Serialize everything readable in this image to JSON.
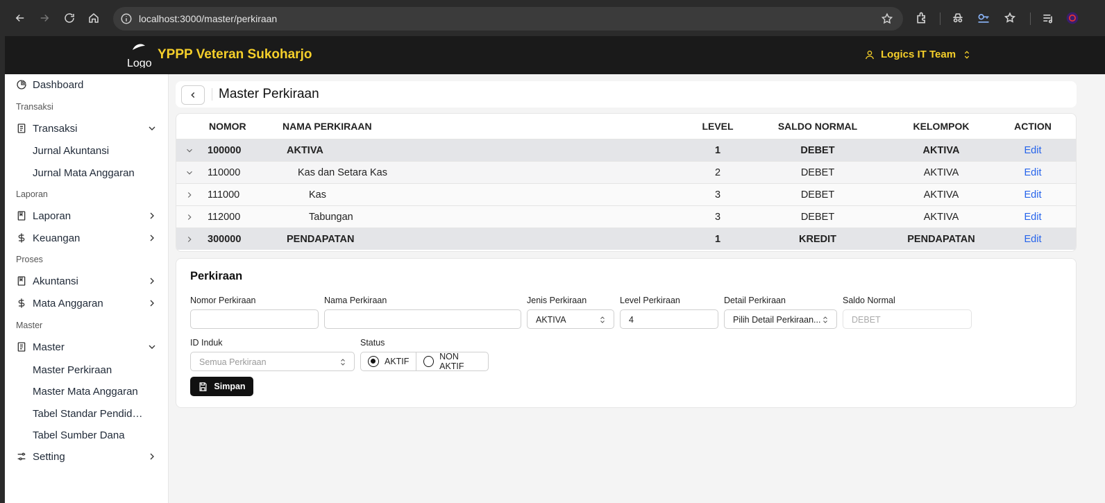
{
  "browser": {
    "url": "localhost:3000/master/perkiraan"
  },
  "header": {
    "logo_alt": "Logo",
    "title": "YPPP Veteran Sukoharjo",
    "team": "Logics IT Team"
  },
  "sidebar": {
    "dashboard": "Dashboard",
    "sections": {
      "transaksi": "Transaksi",
      "laporan": "Laporan",
      "proses": "Proses",
      "master": "Master"
    },
    "items": {
      "transaksi": "Transaksi",
      "jurnal_akuntansi": "Jurnal Akuntansi",
      "jurnal_mata_anggaran": "Jurnal Mata Anggaran",
      "laporan": "Laporan",
      "keuangan": "Keuangan",
      "akuntansi": "Akuntansi",
      "mata_anggaran": "Mata Anggaran",
      "master": "Master",
      "master_perkiraan": "Master Perkiraan",
      "master_mata_anggaran": "Master Mata Anggaran",
      "tabel_standar": "Tabel Standar Pendidik…",
      "tabel_sumber_dana": "Tabel Sumber Dana",
      "setting": "Setting"
    }
  },
  "page": {
    "title": "Master Perkiraan"
  },
  "table": {
    "headers": {
      "nomor": "NOMOR",
      "nama": "NAMA PERKIRAAN",
      "level": "LEVEL",
      "saldo": "SALDO NORMAL",
      "kelompok": "KELOMPOK",
      "action": "ACTION"
    },
    "rows": [
      {
        "nomor": "100000",
        "nama": "AKTIVA",
        "level": "1",
        "saldo": "DEBET",
        "kelompok": "AKTIVA",
        "action": "Edit"
      },
      {
        "nomor": "110000",
        "nama": "Kas dan Setara Kas",
        "level": "2",
        "saldo": "DEBET",
        "kelompok": "AKTIVA",
        "action": "Edit"
      },
      {
        "nomor": "111000",
        "nama": "Kas",
        "level": "3",
        "saldo": "DEBET",
        "kelompok": "AKTIVA",
        "action": "Edit"
      },
      {
        "nomor": "112000",
        "nama": "Tabungan",
        "level": "3",
        "saldo": "DEBET",
        "kelompok": "AKTIVA",
        "action": "Edit"
      },
      {
        "nomor": "300000",
        "nama": "PENDAPATAN",
        "level": "1",
        "saldo": "KREDIT",
        "kelompok": "PENDAPATAN",
        "action": "Edit"
      }
    ]
  },
  "form": {
    "title": "Perkiraan",
    "labels": {
      "nomor": "Nomor Perkiraan",
      "nama": "Nama Perkiraan",
      "jenis": "Jenis Perkiraan",
      "level": "Level Perkiraan",
      "detail": "Detail Perkiraan",
      "saldo": "Saldo Normal",
      "induk": "ID Induk",
      "status": "Status"
    },
    "values": {
      "nomor": "",
      "nama": "",
      "jenis": "AKTIVA",
      "level": "4",
      "detail": "Pilih Detail Perkiraan...",
      "saldo_placeholder": "DEBET",
      "induk_placeholder": "Semua Perkiraan"
    },
    "status_options": {
      "aktif": "AKTIF",
      "non_aktif": "NON AKTIF"
    },
    "save_label": "Simpan"
  }
}
